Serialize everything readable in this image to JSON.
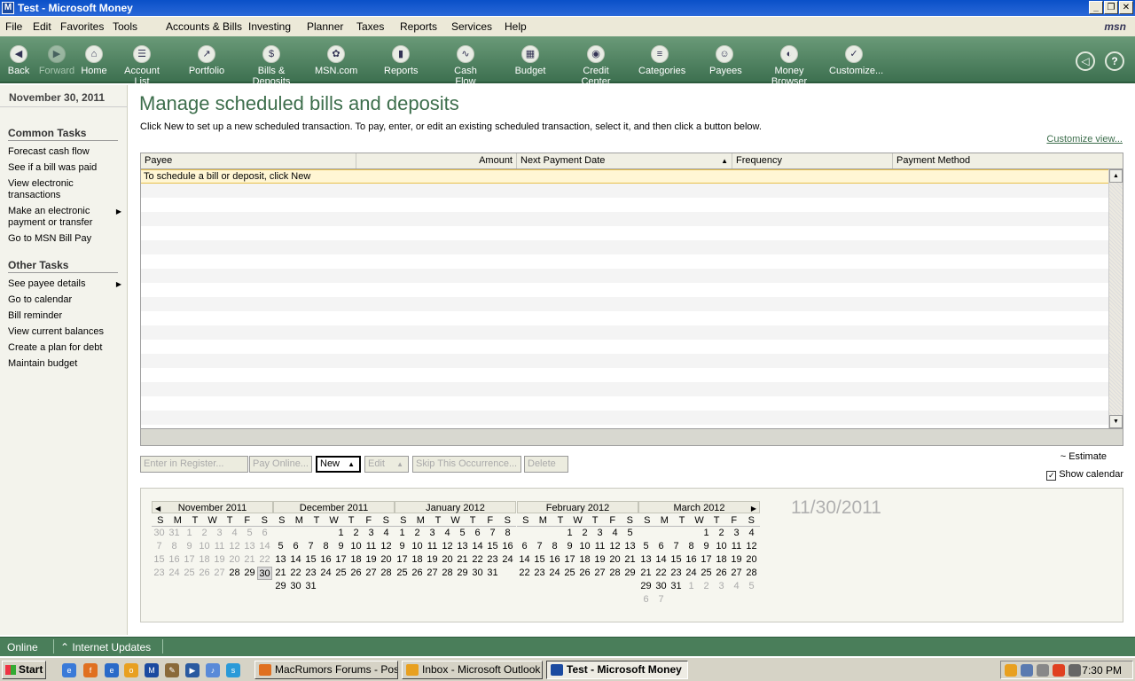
{
  "window": {
    "title": "Test - Microsoft Money",
    "icon": "money-app-icon",
    "controls": [
      "minimize",
      "restore",
      "close"
    ]
  },
  "menu": [
    "File",
    "Edit",
    "Favorites",
    "Tools",
    "Accounts & Bills",
    "Investing",
    "Planner",
    "Taxes",
    "Reports",
    "Services",
    "Help"
  ],
  "brand": "msn",
  "toolbar": [
    {
      "label": "Back",
      "icon": "back-icon",
      "enabled": true
    },
    {
      "label": "Forward",
      "icon": "forward-icon",
      "enabled": false
    },
    {
      "label": "Home",
      "icon": "home-icon",
      "enabled": true
    },
    {
      "label": "Account List",
      "icon": "account-list-icon",
      "enabled": true
    },
    {
      "label": "Portfolio",
      "icon": "portfolio-icon",
      "enabled": true
    },
    {
      "label": "Bills & Deposits",
      "icon": "bills-icon",
      "enabled": true
    },
    {
      "label": "MSN.com",
      "icon": "msn-icon",
      "enabled": true
    },
    {
      "label": "Reports",
      "icon": "reports-icon",
      "enabled": true
    },
    {
      "label": "Cash Flow",
      "icon": "cash-flow-icon",
      "enabled": true
    },
    {
      "label": "Budget",
      "icon": "budget-icon",
      "enabled": true
    },
    {
      "label": "Credit Center",
      "icon": "credit-center-icon",
      "enabled": true
    },
    {
      "label": "Categories",
      "icon": "categories-icon",
      "enabled": true
    },
    {
      "label": "Payees",
      "icon": "payees-icon",
      "enabled": true
    },
    {
      "label": "Money Browser",
      "icon": "money-browser-icon",
      "enabled": true
    },
    {
      "label": "Customize...",
      "icon": "customize-icon",
      "enabled": true
    }
  ],
  "sidebar": {
    "date": "November 30, 2011",
    "common_title": "Common Tasks",
    "common": [
      {
        "label": "Forecast cash flow",
        "submenu": false
      },
      {
        "label": "See if a bill was paid",
        "submenu": false
      },
      {
        "label": "View electronic transactions",
        "submenu": false
      },
      {
        "label": "Make an electronic payment or transfer",
        "submenu": true
      },
      {
        "label": "Go to MSN Bill Pay",
        "submenu": false
      }
    ],
    "other_title": "Other Tasks",
    "other": [
      {
        "label": "See payee details",
        "submenu": true
      },
      {
        "label": "Go to calendar",
        "submenu": false
      },
      {
        "label": "Bill reminder",
        "submenu": false
      },
      {
        "label": "View current balances",
        "submenu": false
      },
      {
        "label": "Create a plan for debt",
        "submenu": false
      },
      {
        "label": "Maintain budget",
        "submenu": false
      }
    ]
  },
  "page": {
    "title": "Manage scheduled bills and deposits",
    "description": "Click New to set up a new scheduled transaction. To pay, enter, or edit an existing scheduled transaction, select it, and then click a button below.",
    "customize": "Customize view..."
  },
  "grid": {
    "columns": [
      "Payee",
      "Amount",
      "Next Payment Date",
      "Frequency",
      "Payment Method"
    ],
    "sorted_column": "Next Payment Date",
    "sort_direction": "ascending",
    "hint": "To schedule a bill or deposit, click New"
  },
  "buttons": [
    {
      "label": "Enter in Register...",
      "enabled": false,
      "dropdown": false
    },
    {
      "label": "Pay Online...",
      "enabled": false,
      "dropdown": false
    },
    {
      "label": "New",
      "enabled": true,
      "dropdown": true
    },
    {
      "label": "Edit",
      "enabled": false,
      "dropdown": true
    },
    {
      "label": "Skip This Occurrence...",
      "enabled": false,
      "dropdown": false
    },
    {
      "label": "Delete",
      "enabled": false,
      "dropdown": false
    }
  ],
  "estimate": "~ Estimate",
  "show_calendar": {
    "label": "Show calendar",
    "checked": true
  },
  "calendar": {
    "weekdays": [
      "S",
      "M",
      "T",
      "W",
      "T",
      "F",
      "S"
    ],
    "selected_date": "11/30/2011",
    "months": [
      {
        "name": "November 2011",
        "days": [
          "30",
          "31",
          "1",
          "2",
          "3",
          "4",
          "5",
          "6",
          "7",
          "8",
          "9",
          "10",
          "11",
          "12",
          "13",
          "14",
          "15",
          "16",
          "17",
          "18",
          "19",
          "20",
          "21",
          "22",
          "23",
          "24",
          "25",
          "26",
          "27",
          "28",
          "29",
          "30"
        ],
        "muted": [
          0,
          1,
          2,
          3,
          4,
          5,
          6,
          7,
          8,
          9,
          10,
          11,
          12,
          13,
          14,
          15,
          16,
          17,
          18,
          19,
          20,
          21,
          22,
          23,
          24,
          25,
          26,
          27,
          28
        ],
        "today": 31
      },
      {
        "name": "December 2011",
        "days": [
          "",
          "",
          "",
          "",
          "1",
          "2",
          "3",
          "4",
          "5",
          "6",
          "7",
          "8",
          "9",
          "10",
          "11",
          "12",
          "13",
          "14",
          "15",
          "16",
          "17",
          "18",
          "19",
          "20",
          "21",
          "22",
          "23",
          "24",
          "25",
          "26",
          "27",
          "28",
          "29",
          "30",
          "31"
        ],
        "muted": [],
        "today": -1
      },
      {
        "name": "January 2012",
        "days": [
          "1",
          "2",
          "3",
          "4",
          "5",
          "6",
          "7",
          "8",
          "9",
          "10",
          "11",
          "12",
          "13",
          "14",
          "15",
          "16",
          "17",
          "18",
          "19",
          "20",
          "21",
          "22",
          "23",
          "24",
          "25",
          "26",
          "27",
          "28",
          "29",
          "30",
          "31"
        ],
        "muted": [],
        "today": -1
      },
      {
        "name": "February 2012",
        "days": [
          "",
          "",
          "",
          "1",
          "2",
          "3",
          "4",
          "5",
          "6",
          "7",
          "8",
          "9",
          "10",
          "11",
          "12",
          "13",
          "14",
          "15",
          "16",
          "17",
          "18",
          "19",
          "20",
          "21",
          "22",
          "23",
          "24",
          "25",
          "26",
          "27",
          "28",
          "29"
        ],
        "muted": [],
        "today": -1
      },
      {
        "name": "March 2012",
        "days": [
          "",
          "",
          "",
          "",
          "1",
          "2",
          "3",
          "4",
          "5",
          "6",
          "7",
          "8",
          "9",
          "10",
          "11",
          "12",
          "13",
          "14",
          "15",
          "16",
          "17",
          "18",
          "19",
          "20",
          "21",
          "22",
          "23",
          "24",
          "25",
          "26",
          "27",
          "28",
          "29",
          "30",
          "31",
          "1",
          "2",
          "3",
          "4",
          "5",
          "6",
          "7"
        ],
        "muted": [
          35,
          36,
          37,
          38,
          39,
          40,
          41
        ],
        "today": -1
      }
    ]
  },
  "status": {
    "online": "Online",
    "updates": "Internet Updates"
  },
  "taskbar": {
    "start": "Start",
    "quicklaunch": [
      "ie-icon",
      "firefox-icon",
      "ie-alt-icon",
      "outlook-icon",
      "money-icon",
      "paint-icon",
      "media-player-icon",
      "itunes-icon",
      "skype-icon"
    ],
    "tasks": [
      {
        "label": "MacRumors Forums - Pos...",
        "icon": "firefox-icon",
        "active": false
      },
      {
        "label": "Inbox - Microsoft Outlook",
        "icon": "outlook-icon",
        "active": false
      },
      {
        "label": "Test - Microsoft Money",
        "icon": "money-icon",
        "active": true
      }
    ],
    "tray": [
      "money-tray-icon",
      "network-icon",
      "volume-icon",
      "security-icon",
      "power-icon"
    ],
    "clock": "7:30 PM"
  },
  "colors": {
    "title_bar": "#0a50c8",
    "toolbar": "#4f8260",
    "accent": "#3d6e4c",
    "hint_row": "#fff6d4"
  }
}
